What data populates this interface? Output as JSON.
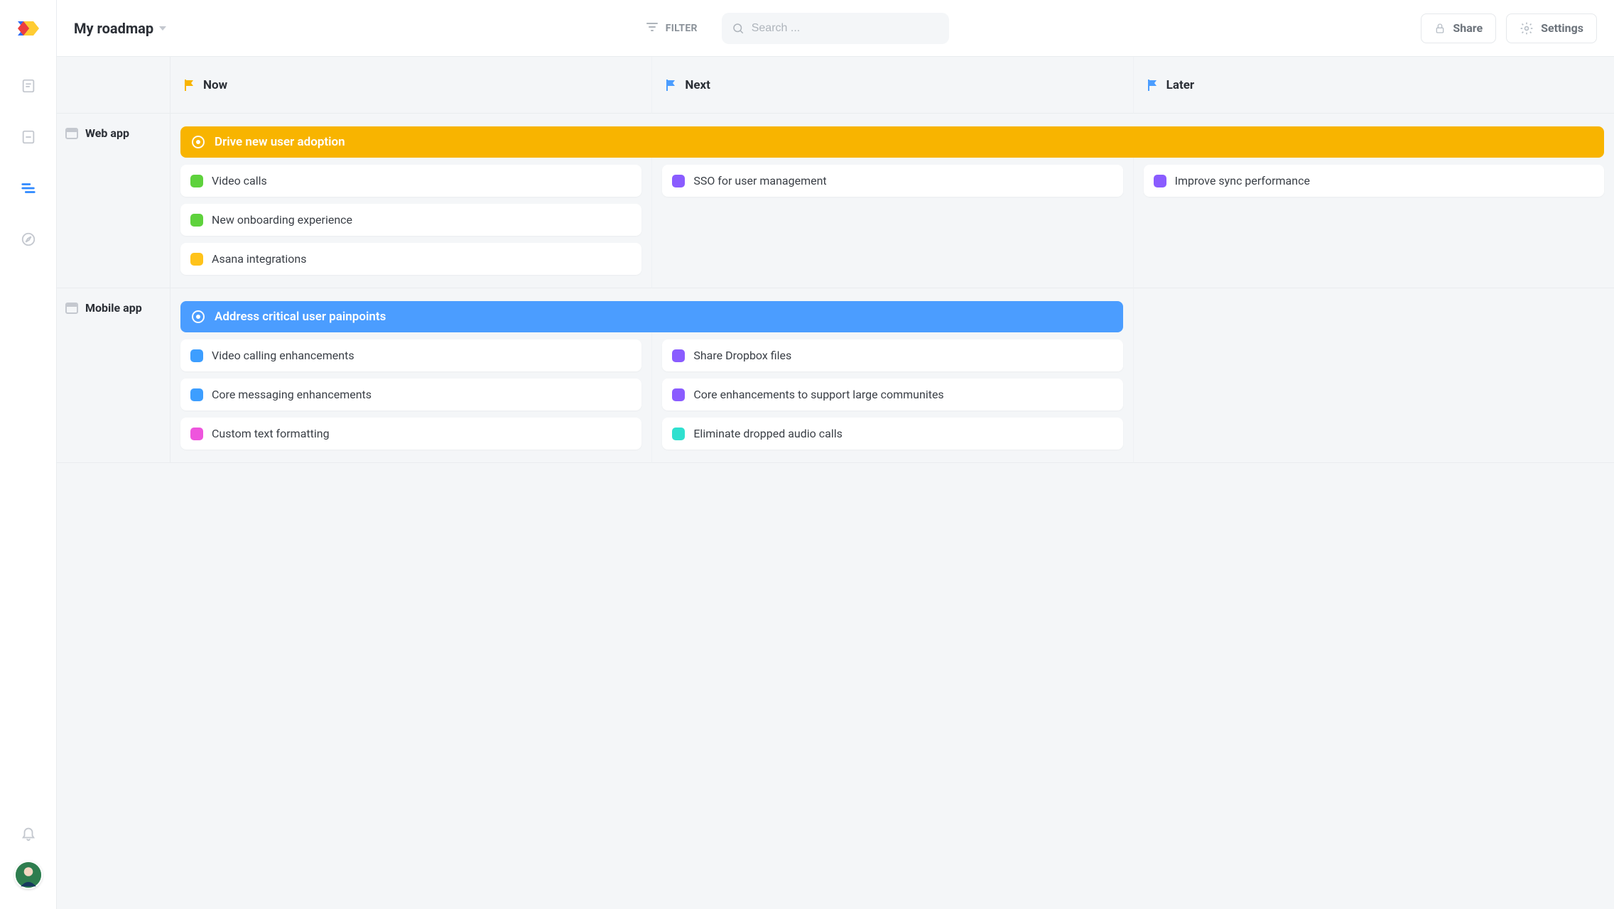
{
  "header": {
    "title": "My roadmap",
    "filter_label": "FILTER",
    "search_placeholder": "Search ...",
    "share_label": "Share",
    "settings_label": "Settings"
  },
  "columns": [
    {
      "id": "now",
      "label": "Now",
      "flag": "orange"
    },
    {
      "id": "next",
      "label": "Next",
      "flag": "blue"
    },
    {
      "id": "later",
      "label": "Later",
      "flag": "blue"
    }
  ],
  "rows": [
    {
      "id": "web",
      "label": "Web app",
      "objective": {
        "label": "Drive new user adoption",
        "color": "#f8b400",
        "span_columns": 3
      },
      "stages": {
        "now": [
          {
            "label": "Video calls",
            "swatch": "green"
          },
          {
            "label": "New onboarding experience",
            "swatch": "green"
          },
          {
            "label": "Asana integrations",
            "swatch": "yellow"
          }
        ],
        "next": [
          {
            "label": "SSO for user management",
            "swatch": "purple"
          }
        ],
        "later": [
          {
            "label": "Improve sync performance",
            "swatch": "purple"
          }
        ]
      }
    },
    {
      "id": "mobile",
      "label": "Mobile app",
      "objective": {
        "label": "Address critical user painpoints",
        "color": "#4b9dff",
        "span_columns": 2
      },
      "stages": {
        "now": [
          {
            "label": "Video calling enhancements",
            "swatch": "blue"
          },
          {
            "label": "Core messaging enhancements",
            "swatch": "blue"
          },
          {
            "label": "Custom text formatting",
            "swatch": "pink"
          }
        ],
        "next": [
          {
            "label": "Share Dropbox files",
            "swatch": "purple"
          },
          {
            "label": "Core enhancements to support large communites",
            "swatch": "purple"
          },
          {
            "label": "Eliminate dropped audio calls",
            "swatch": "teal"
          }
        ],
        "later": []
      }
    }
  ]
}
